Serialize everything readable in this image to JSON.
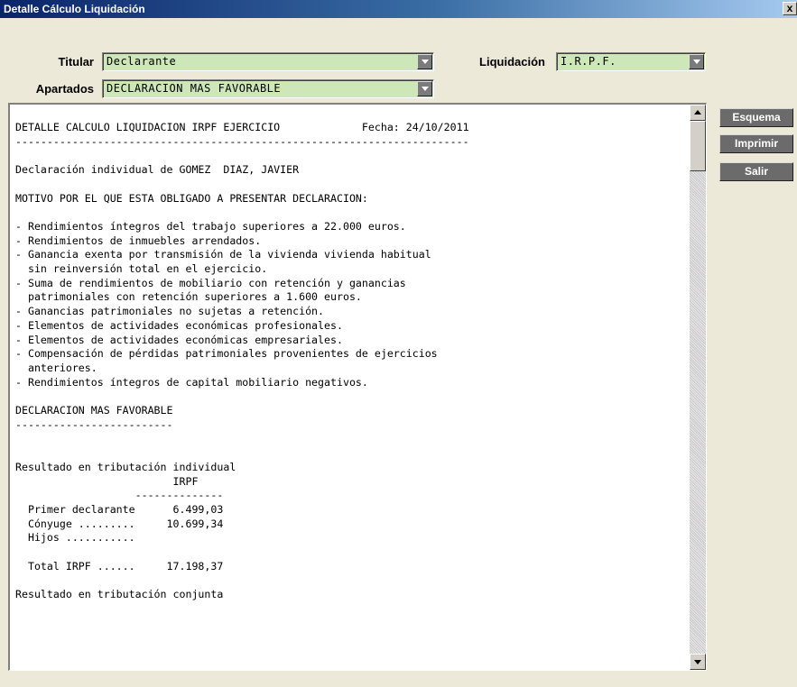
{
  "window": {
    "title": "Detalle Cálculo Liquidación",
    "close_label": "x"
  },
  "form": {
    "titular_label": "Titular",
    "titular_value": "Declarante",
    "liquidacion_label": "Liquidación",
    "liquidacion_value": "I.R.P.F.",
    "apartados_label": "Apartados",
    "apartados_value": "DECLARACION MAS FAVORABLE"
  },
  "buttons": {
    "esquema": "Esquema",
    "imprimir": "Imprimir",
    "salir": "Salir"
  },
  "colors": {
    "field_bg": "#cde7b9",
    "button_bg": "#6b6b6b",
    "title_bar": "#0a246a"
  },
  "report": {
    "text": "DETALLE CALCULO LIQUIDACION IRPF EJERCICIO             Fecha: 24/10/2011\n------------------------------------------------------------------------\n\nDeclaración individual de GOMEZ  DIAZ, JAVIER\n\nMOTIVO POR EL QUE ESTA OBLIGADO A PRESENTAR DECLARACION:\n\n- Rendimientos íntegros del trabajo superiores a 22.000 euros.\n- Rendimientos de inmuebles arrendados.\n- Ganancia exenta por transmisión de la vivienda vivienda habitual\n  sin reinversión total en el ejercicio.\n- Suma de rendimientos de mobiliario con retención y ganancias\n  patrimoniales con retención superiores a 1.600 euros.\n- Ganancias patrimoniales no sujetas a retención.\n- Elementos de actividades económicas profesionales.\n- Elementos de actividades económicas empresariales.\n- Compensación de pérdidas patrimoniales provenientes de ejercicios\n  anteriores.\n- Rendimientos íntegros de capital mobiliario negativos.\n\nDECLARACION MAS FAVORABLE\n-------------------------\n\n\nResultado en tributación individual\n                         IRPF\n                   --------------\n  Primer declarante      6.499,03\n  Cónyuge .........     10.699,34\n  Hijos ...........\n\n  Total IRPF ......     17.198,37\n\nResultado en tributación conjunta"
  }
}
